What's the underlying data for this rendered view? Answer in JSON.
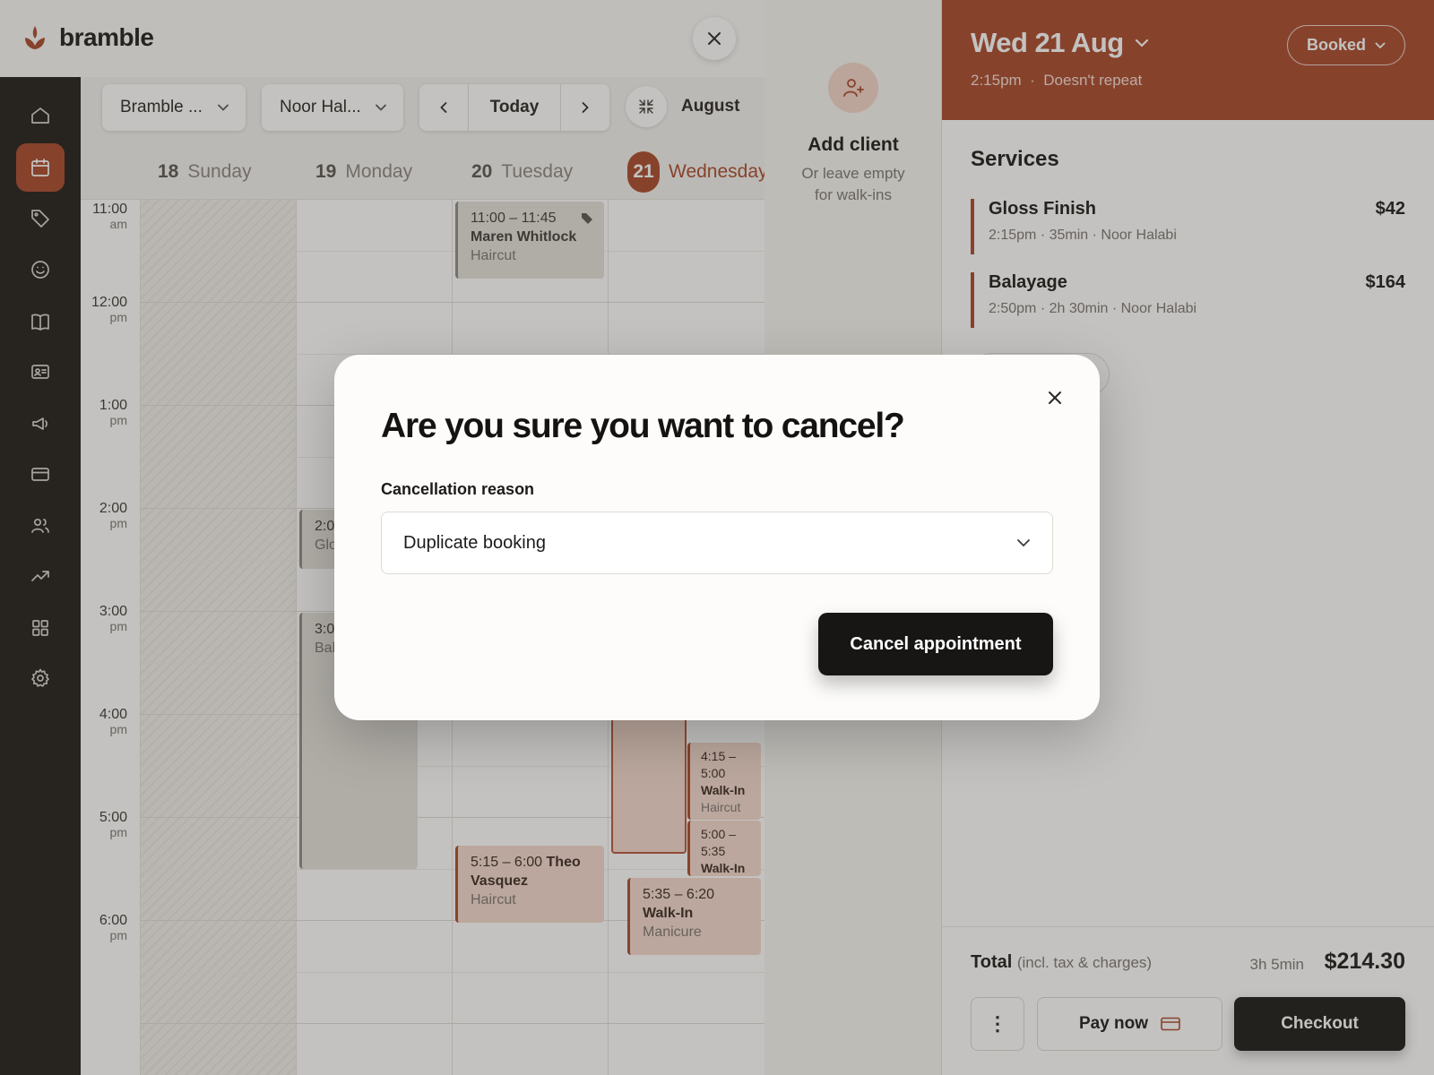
{
  "brand": {
    "name": "bramble"
  },
  "toolbar": {
    "location": "Bramble ...",
    "staff": "Noor Hal...",
    "today": "Today",
    "month": "August"
  },
  "days": [
    {
      "num": "18",
      "name": "Sunday"
    },
    {
      "num": "19",
      "name": "Monday"
    },
    {
      "num": "20",
      "name": "Tuesday"
    },
    {
      "num": "21",
      "name": "Wednesday"
    }
  ],
  "times": [
    {
      "t": "11:00",
      "p": "am"
    },
    {
      "t": "12:00",
      "p": "pm"
    },
    {
      "t": "1:00",
      "p": "pm"
    },
    {
      "t": "2:00",
      "p": "pm"
    },
    {
      "t": "3:00",
      "p": "pm"
    },
    {
      "t": "4:00",
      "p": "pm"
    },
    {
      "t": "5:00",
      "p": "pm"
    },
    {
      "t": "6:00",
      "p": "pm"
    }
  ],
  "appointments": {
    "maren": {
      "time": "11:00 – 11:45",
      "client": "Maren Whitlock",
      "service": "Haircut"
    },
    "gloss": {
      "time": "2:0",
      "service": "Glo"
    },
    "balayage": {
      "time": "3:0",
      "service": "Bal"
    },
    "theo": {
      "time": "5:15 – 6:00",
      "client": "Theo Vasquez",
      "service": "Haircut"
    },
    "walkin1": {
      "time": "4:15 – 5:00",
      "client": "Walk-In",
      "service": "Haircut"
    },
    "walkin2": {
      "time": "5:00 – 5:35",
      "client": "Walk-In"
    },
    "walkin3": {
      "time": "5:35 – 6:20",
      "client": "Walk-In",
      "service": "Manicure"
    }
  },
  "client": {
    "title": "Add client",
    "subtitle_1": "Or leave empty",
    "subtitle_2": "for walk-ins"
  },
  "panel": {
    "date": "Wed 21 Aug",
    "time": "2:15pm",
    "repeat": "Doesn't repeat",
    "status": "Booked",
    "services_title": "Services",
    "services": [
      {
        "name": "Gloss Finish",
        "details": "2:15pm · 35min · Noor Halabi",
        "price": "$42"
      },
      {
        "name": "Balayage",
        "details": "2:50pm · 2h 30min · Noor Halabi",
        "price": "$164"
      }
    ],
    "total_label": "Total",
    "total_note": "(incl. tax & charges)",
    "duration": "3h 5min",
    "total": "$214.30",
    "more": "⋮",
    "pay_now": "Pay now",
    "checkout": "Checkout"
  },
  "modal": {
    "title": "Are you sure you want to cancel?",
    "reason_label": "Cancellation reason",
    "reason_value": "Duplicate booking",
    "confirm": "Cancel appointment"
  },
  "colors": {
    "accent": "#a9482c",
    "sidebar": "#201d1b",
    "dark_button": "#181615"
  }
}
